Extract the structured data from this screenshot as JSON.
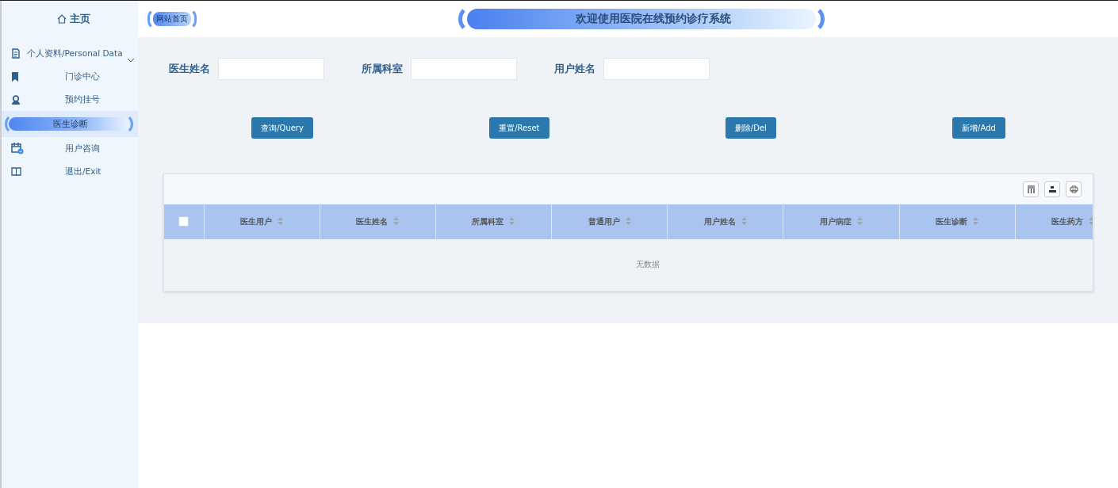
{
  "sidebar": {
    "home": "主页",
    "items": [
      {
        "label": "个人资料/Personal Data",
        "kind": "group",
        "selected": false
      },
      {
        "label": "门诊中心",
        "kind": "link",
        "selected": false
      },
      {
        "label": "预约挂号",
        "kind": "link",
        "selected": false
      },
      {
        "label": "医生诊断",
        "kind": "link",
        "selected": true
      },
      {
        "label": "用户咨询",
        "kind": "link",
        "selected": false
      },
      {
        "label": "退出/Exit",
        "kind": "link",
        "selected": false
      }
    ]
  },
  "header": {
    "site_link": "网站首页",
    "title": "欢迎使用医院在线预约诊疗系统"
  },
  "search": {
    "fields": [
      {
        "label": "医生姓名"
      },
      {
        "label": "所属科室"
      },
      {
        "label": "用户姓名"
      }
    ],
    "buttons": [
      "查询/Query",
      "重置/Reset",
      "删除/Del",
      "新增/Add"
    ]
  },
  "table": {
    "select_all_checked": false,
    "columns": [
      "医生用户",
      "医生姓名",
      "所属科室",
      "普通用户",
      "用户姓名",
      "用户病症",
      "医生诊断",
      "医生药方"
    ],
    "empty_text": "无数据"
  }
}
